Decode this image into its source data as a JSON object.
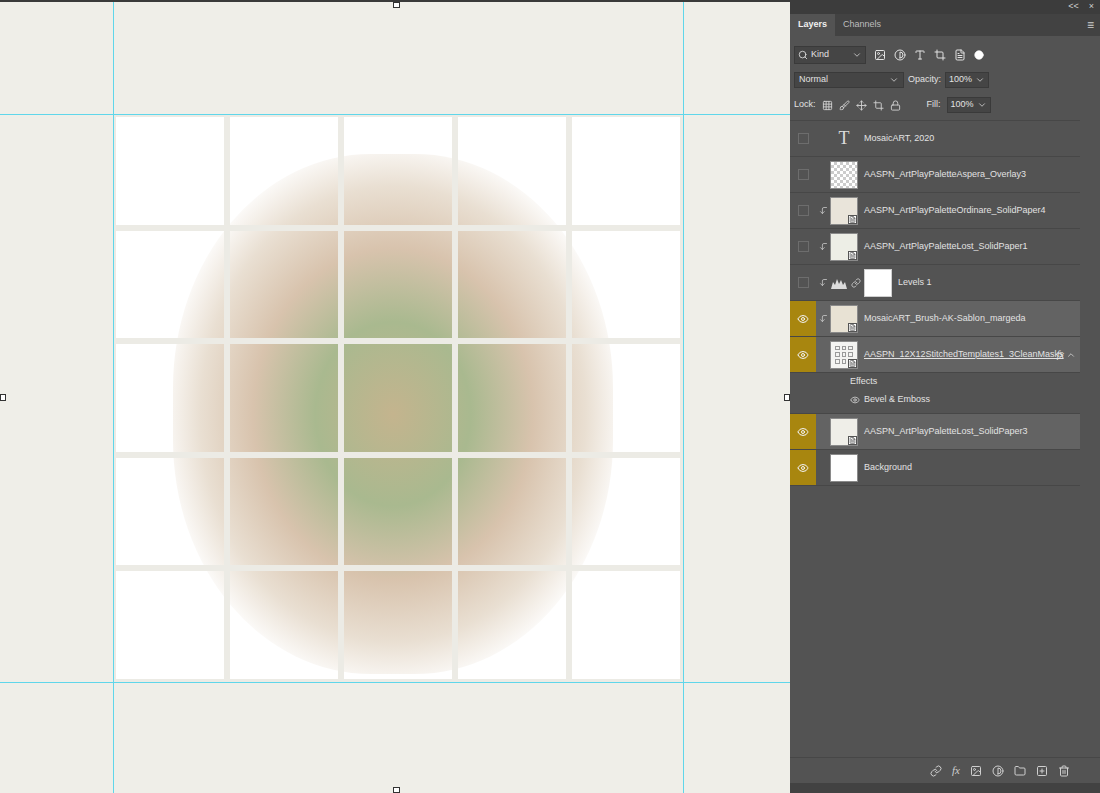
{
  "panel": {
    "collapse": "<<",
    "close": "×",
    "menu": "≡"
  },
  "tabs": [
    {
      "label": "Layers",
      "selected": true
    },
    {
      "label": "Channels",
      "selected": false
    }
  ],
  "filter": {
    "label": "Kind"
  },
  "blend": {
    "mode": "Normal",
    "opacity_label": "Opacity:",
    "opacity": "100%"
  },
  "lock": {
    "label": "Lock:",
    "fill_label": "Fill:",
    "fill": "100%"
  },
  "layers": [
    {
      "name": "MosaicART, 2020",
      "kind": "text",
      "thumb_text": "T",
      "visible": false,
      "selected": false,
      "clipped": false,
      "smart": false,
      "color": "#535353"
    },
    {
      "name": "AASPN_ArtPlayPaletteAspera_Overlay3",
      "kind": "transparent",
      "visible": false,
      "selected": false,
      "clipped": false,
      "smart": false,
      "color": "#ffffff"
    },
    {
      "name": "AASPN_ArtPlayPaletteOrdinare_SolidPaper4",
      "kind": "paper",
      "visible": false,
      "selected": false,
      "clipped": true,
      "smart": true,
      "color": "#e9e4da"
    },
    {
      "name": "AASPN_ArtPlayPaletteLost_SolidPaper1",
      "kind": "paper",
      "visible": false,
      "selected": false,
      "clipped": true,
      "smart": true,
      "color": "#edeee6"
    },
    {
      "name": "Levels 1",
      "kind": "adjustment",
      "visible": false,
      "selected": false,
      "clipped": true,
      "smart": false,
      "color": "#ffffff"
    },
    {
      "name": "MosaicART_Brush-AK-Sablon_margeda",
      "kind": "paper",
      "visible": true,
      "selected": true,
      "clipped": true,
      "smart": true,
      "color": "#e8e2d4"
    },
    {
      "name": "AASPN_12X12StitchedTemplates1_3CleanMasks",
      "kind": "template",
      "visible": true,
      "selected": true,
      "clipped": false,
      "smart": true,
      "color": "#f4f4f2",
      "fx": "fx",
      "expanded": true,
      "effects": {
        "label": "Effects",
        "items": [
          {
            "name": "Bevel & Emboss",
            "visible": true
          }
        ]
      }
    },
    {
      "name": "AASPN_ArtPlayPaletteLost_SolidPaper3",
      "kind": "paper",
      "visible": true,
      "selected": true,
      "clipped": false,
      "smart": true,
      "color": "#efeee8"
    },
    {
      "name": "Background",
      "kind": "plain",
      "visible": true,
      "selected": false,
      "clipped": false,
      "smart": false,
      "color": "#ffffff"
    }
  ],
  "bottom_bar": {
    "fx": "fx"
  }
}
